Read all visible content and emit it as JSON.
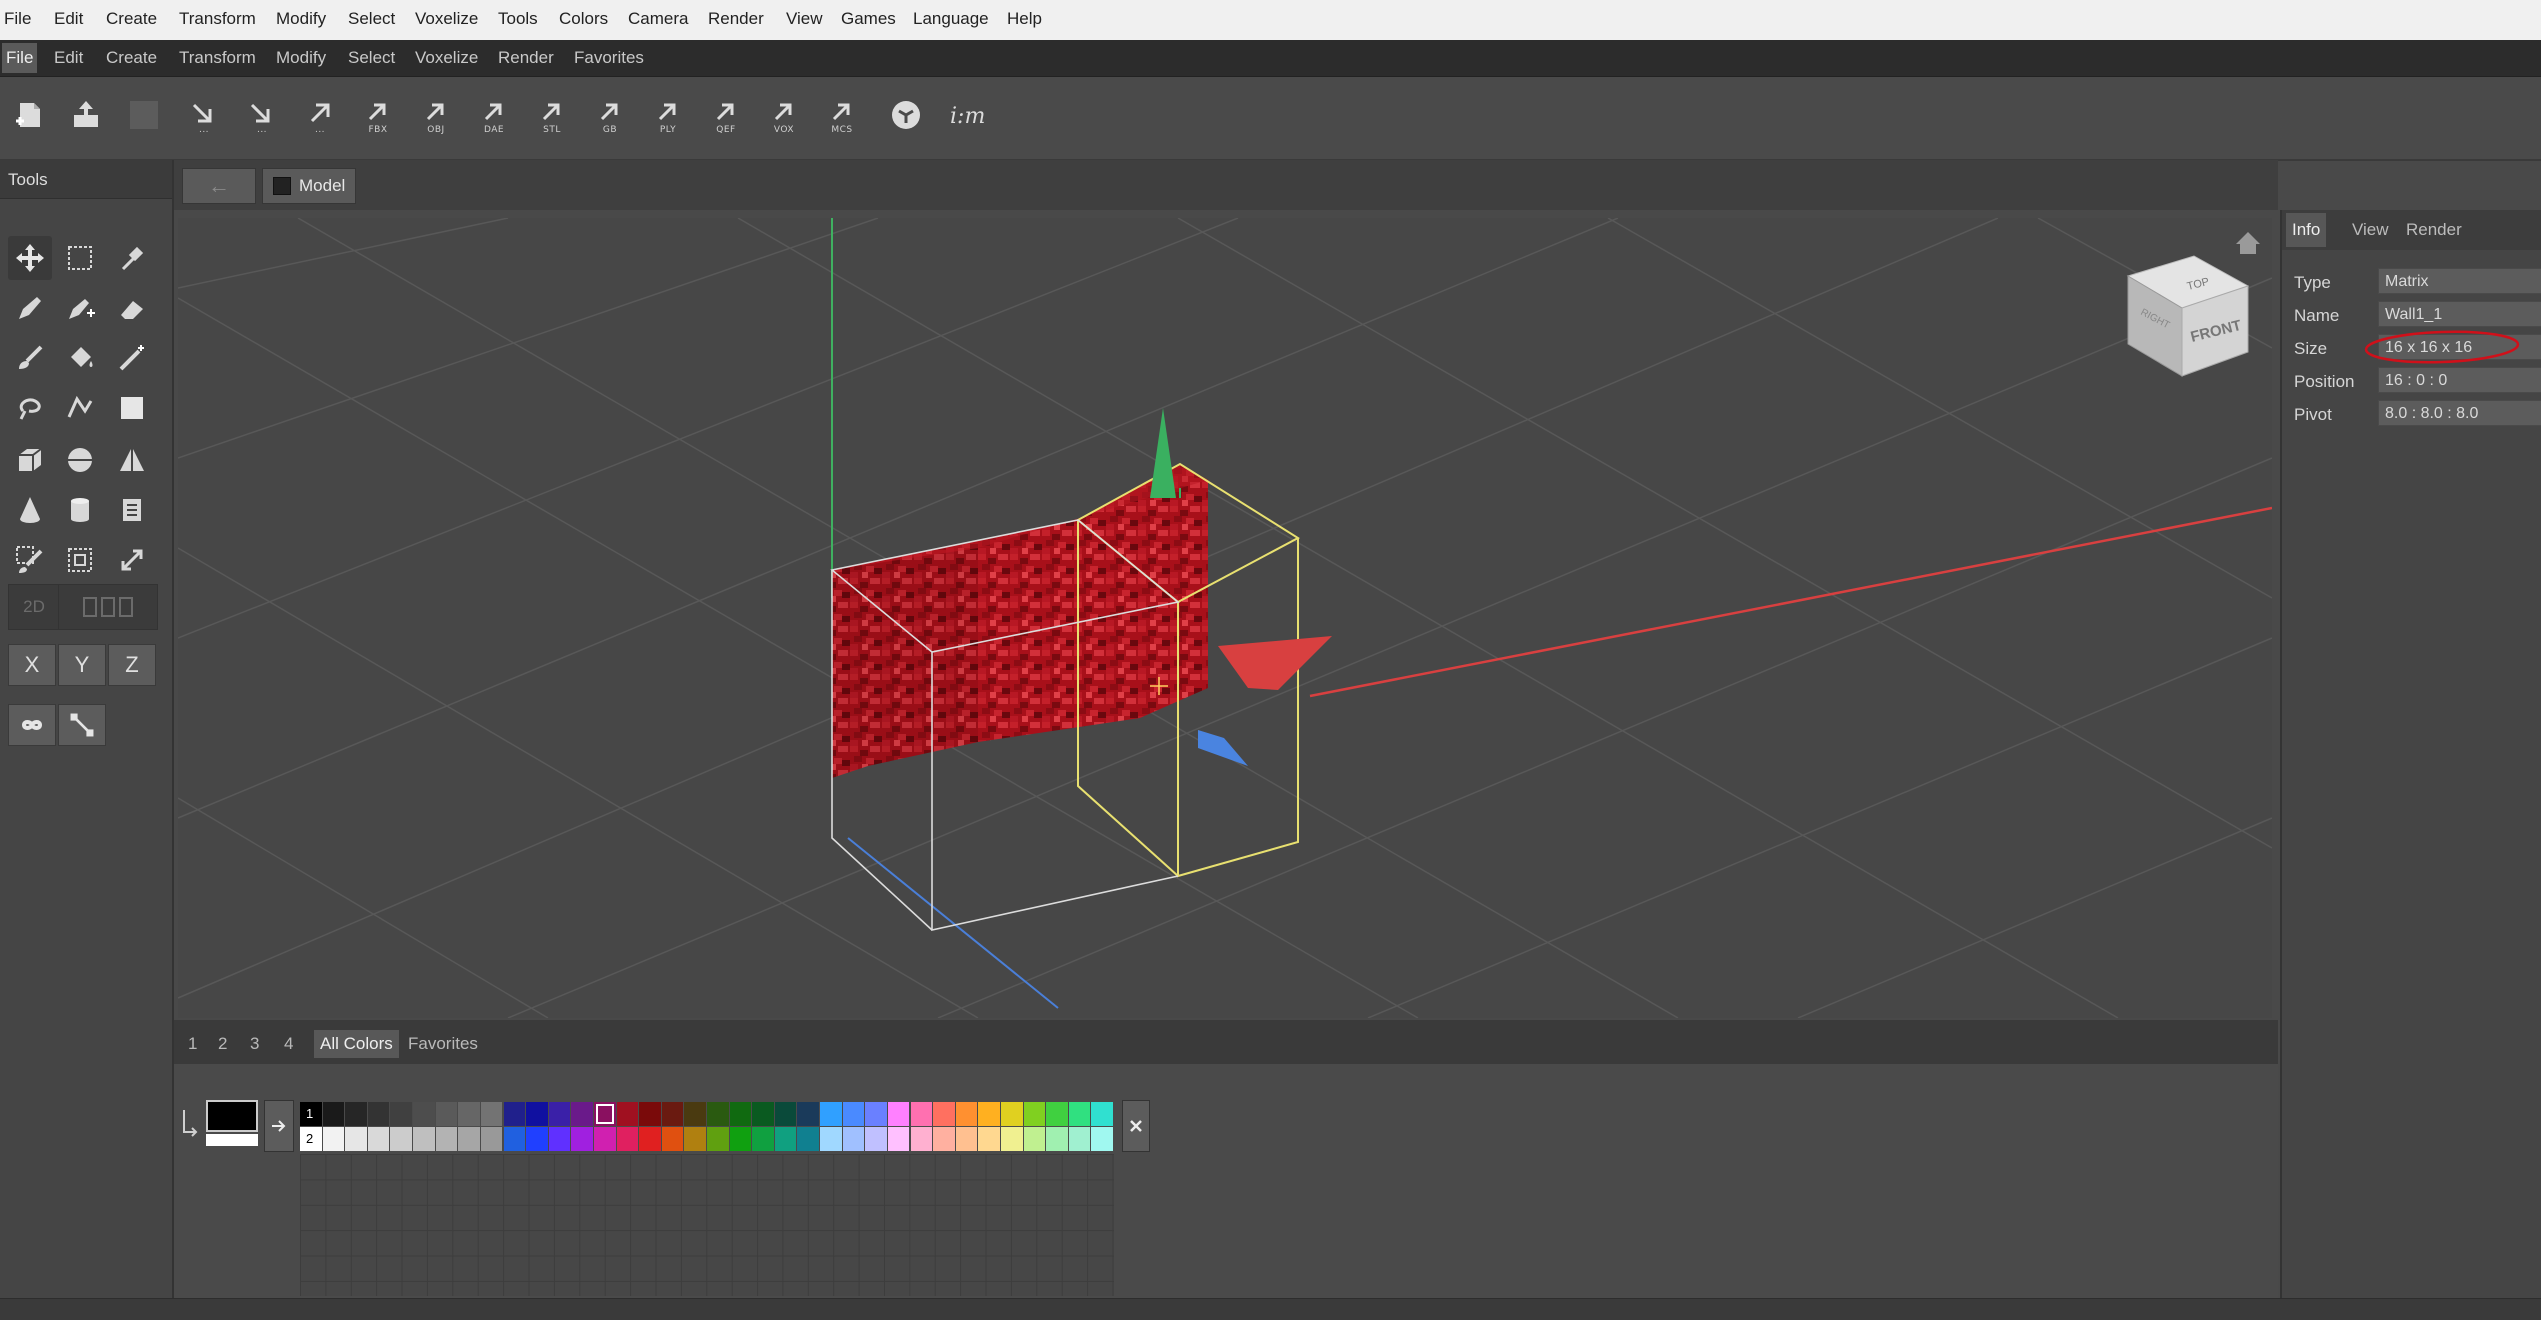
{
  "menu_primary": [
    "File",
    "Edit",
    "Create",
    "Transform",
    "Modify",
    "Select",
    "Voxelize",
    "Tools",
    "Colors",
    "Camera",
    "Render",
    "View",
    "Games",
    "Language",
    "Help"
  ],
  "menu_secondary": [
    "File",
    "Edit",
    "Create",
    "Transform",
    "Modify",
    "Select",
    "Voxelize",
    "Render",
    "Favorites"
  ],
  "toolbar": {
    "export_captions": [
      "...",
      "...",
      "...",
      "FBX",
      "OBJ",
      "DAE",
      "STL",
      "GB",
      "PLY",
      "QEF",
      "VOX",
      "MCS"
    ],
    "icons": [
      "new-file-icon",
      "open-file-icon",
      "save-icon",
      "export-icon",
      "export-icon",
      "export-icon",
      "export-fbx-icon",
      "export-obj-icon",
      "export-dae-icon",
      "export-stl-icon",
      "export-gb-icon",
      "export-ply-icon",
      "export-qef-icon",
      "export-vox-icon",
      "export-mcs-icon",
      "sketchfab-icon",
      "im-icon"
    ]
  },
  "tools_panel": {
    "title": "Tools",
    "tools": [
      "move-icon",
      "box-select-icon",
      "eyedropper-icon",
      "pencil-icon",
      "pencil-add-icon",
      "eraser-icon",
      "brush-icon",
      "fill-bucket-icon",
      "magic-wand-icon",
      "lasso-icon",
      "polyline-icon",
      "rectangle-icon",
      "cube-icon",
      "sphere-icon",
      "pyramid-icon",
      "cone-icon",
      "cylinder-icon",
      "text-icon",
      "paint-select-icon",
      "crop-icon",
      "resize-icon"
    ],
    "mode_label": "2D",
    "axes": [
      "X",
      "Y",
      "Z"
    ]
  },
  "viewport_bar": {
    "back_glyph": "←",
    "breadcrumb": "Model"
  },
  "view_cube": {
    "top": "TOP",
    "front": "FRONT",
    "side": "RIGHT"
  },
  "right_panel": {
    "tabs": [
      "Info",
      "View",
      "Render"
    ],
    "active_tab": "Info",
    "properties": [
      {
        "label": "Type",
        "value": "Matrix"
      },
      {
        "label": "Name",
        "value": "Wall1_1"
      },
      {
        "label": "Size",
        "value": "16 x 16 x 16"
      },
      {
        "label": "Position",
        "value": "16 : 0 : 0"
      },
      {
        "label": "Pivot",
        "value": "8.0 : 8.0 : 8.0"
      }
    ]
  },
  "palette": {
    "tabs": [
      "1",
      "2",
      "3",
      "4",
      "All Colors",
      "Favorites"
    ],
    "active_tab": "All Colors",
    "row_numbers": [
      "1",
      "2"
    ],
    "row1": [
      "#000000",
      "#1a1a1a",
      "#262626",
      "#333333",
      "#404040",
      "#4d4d4d",
      "#5a5a5a",
      "#666666",
      "#737373",
      "#20208c",
      "#1010a0",
      "#3a20a8",
      "#6a1a8a",
      "#8a1060",
      "#a01020",
      "#7a0a0a",
      "#6a1a10",
      "#4a3a10",
      "#2a5a10",
      "#106a10",
      "#0a5a20",
      "#0a4a3a",
      "#1a3a5a",
      "#30a0ff",
      "#4a8aff",
      "#6a80ff",
      "#ff80ff",
      "#ff70b0",
      "#ff7060",
      "#ff9030",
      "#ffb020",
      "#e0d020",
      "#80d020",
      "#40d040",
      "#30e080",
      "#30e0d0"
    ],
    "row2": [
      "#ffffff",
      "#f2f2f2",
      "#e6e6e6",
      "#d9d9d9",
      "#cccccc",
      "#bfbfbf",
      "#b3b3b3",
      "#a6a6a6",
      "#999999",
      "#2060e0",
      "#2040ff",
      "#6030ff",
      "#a020e0",
      "#d020b0",
      "#e02060",
      "#e02020",
      "#e05010",
      "#b08010",
      "#60a010",
      "#10a010",
      "#10a040",
      "#10a080",
      "#108090",
      "#a0d8ff",
      "#a0c0ff",
      "#c0c0ff",
      "#ffc0ff",
      "#ffb0d0",
      "#ffb0a0",
      "#ffc090",
      "#ffd890",
      "#f0f090",
      "#c0f090",
      "#a0f0b0",
      "#a0f0d0",
      "#a0f8f0"
    ],
    "selected_index": 13
  }
}
